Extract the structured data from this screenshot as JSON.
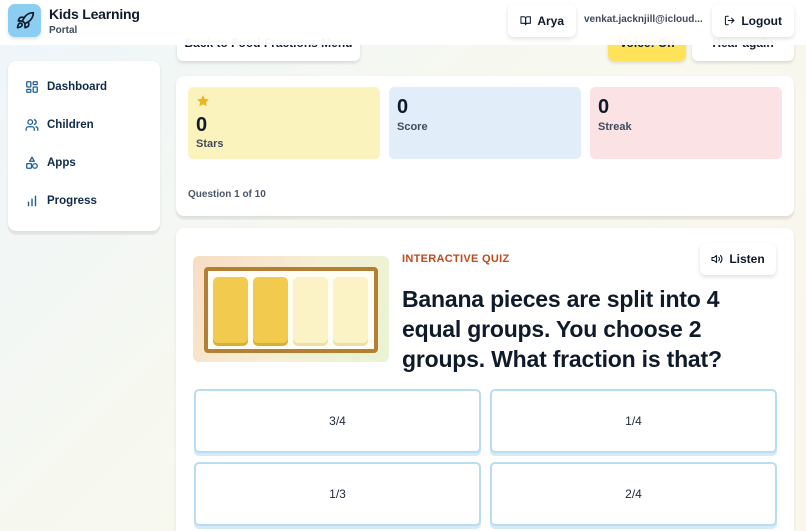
{
  "app": {
    "title": "Kids Learning",
    "subtitle": "Portal"
  },
  "header": {
    "user_label": "Arya",
    "email": "venkat.jacknjill@icloud...",
    "logout_label": "Logout"
  },
  "top_actions": {
    "back_label": "Back to Food Fractions Menu",
    "voice_label": "Voice: On",
    "hear_again_label": "Hear again"
  },
  "sidebar": {
    "items": [
      {
        "label": "Dashboard",
        "icon": "dashboard-icon"
      },
      {
        "label": "Children",
        "icon": "users-icon"
      },
      {
        "label": "Apps",
        "icon": "shapes-icon"
      },
      {
        "label": "Progress",
        "icon": "bar-chart-icon"
      }
    ]
  },
  "stats": {
    "stars": {
      "value": "0",
      "label": "Stars",
      "color": "#fbf3bd"
    },
    "score": {
      "value": "0",
      "label": "Score",
      "color": "#e1edf8"
    },
    "streak": {
      "value": "0",
      "label": "Streak",
      "color": "#fbe2e4"
    },
    "question_count": "Question 1 of 10"
  },
  "quiz": {
    "tag": "INTERACTIVE QUIZ",
    "listen_label": "Listen",
    "question": "Banana pieces are split into 4 equal groups. You choose 2 groups. What fraction is that?",
    "illustration": {
      "total_pieces": 4,
      "selected_pieces": 2
    },
    "options": [
      "3/4",
      "1/4",
      "1/3",
      "2/4"
    ]
  },
  "colors": {
    "accent_orange": "#c2491c",
    "voice_yellow": "#fde25a",
    "option_border": "#b9dcf2",
    "piece_selected": "#f2ca4d",
    "piece_empty": "#fbf3c6",
    "tray_border": "#b37f33"
  }
}
